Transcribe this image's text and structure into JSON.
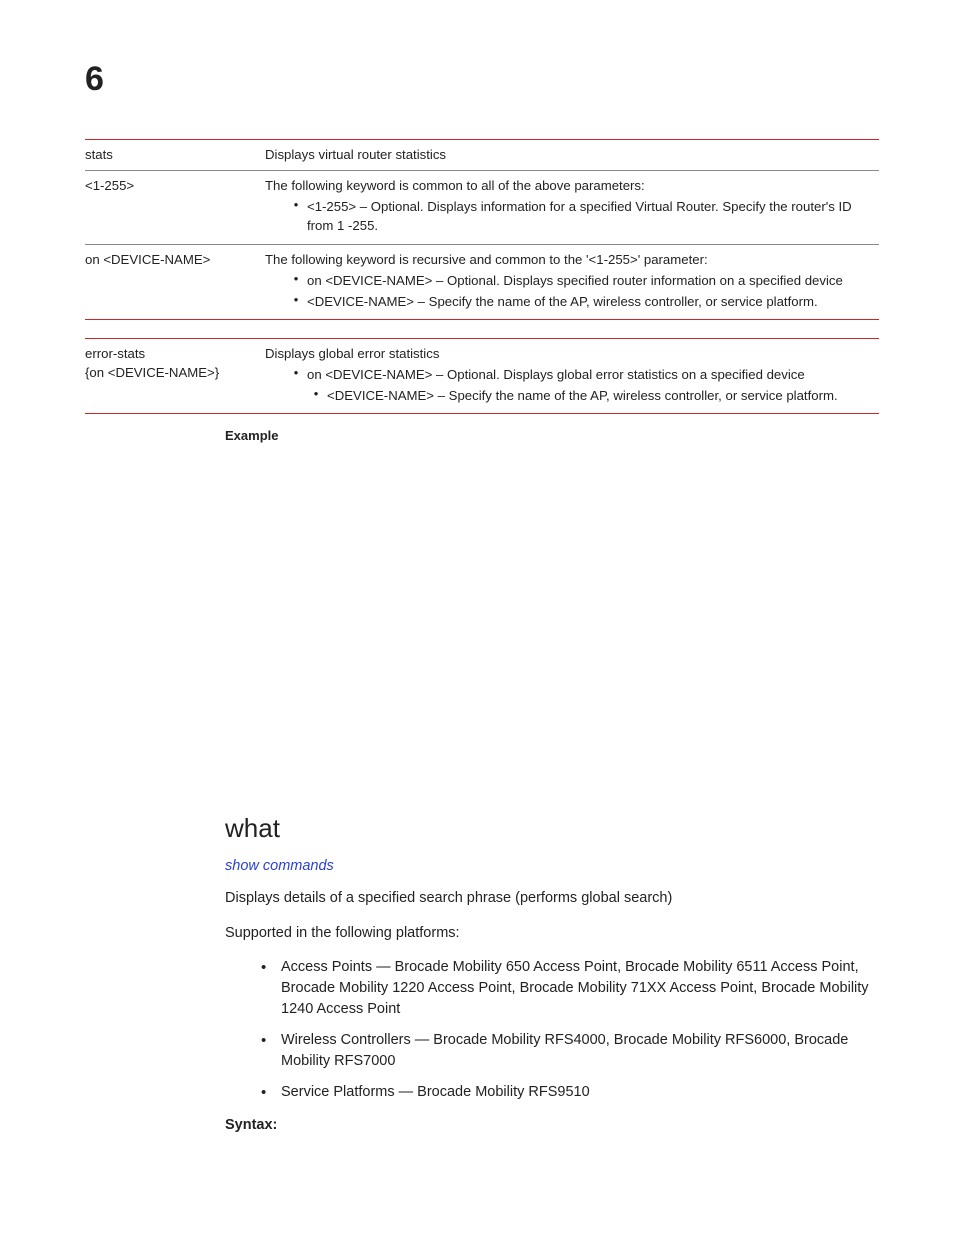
{
  "chapter": "6",
  "table1": {
    "rows": [
      {
        "key": "stats",
        "desc": {
          "intro": "Displays virtual router statistics",
          "bullets": []
        }
      },
      {
        "key": "<1-255>",
        "desc": {
          "intro": "The following keyword is common to all of the above parameters:",
          "bullets": [
            {
              "indent": 1,
              "text": "<1-255> – Optional. Displays information for a specified Virtual Router. Specify the router's ID from 1 -255."
            }
          ]
        }
      },
      {
        "key": "on <DEVICE-NAME>",
        "desc": {
          "intro": "The following keyword is recursive and common to the '<1-255>' parameter:",
          "bullets": [
            {
              "indent": 1,
              "text": "on <DEVICE-NAME> – Optional. Displays specified router information on a specified device"
            },
            {
              "indent": 1,
              "text": "<DEVICE-NAME> – Specify the name of the AP, wireless controller, or service platform."
            }
          ]
        }
      }
    ]
  },
  "table2": {
    "rows": [
      {
        "key_lines": [
          "error-stats",
          "{on <DEVICE-NAME>}"
        ],
        "desc": {
          "intro": "Displays global error statistics",
          "bullets": [
            {
              "indent": 1,
              "text": "on <DEVICE-NAME> – Optional. Displays global error statistics on a specified device"
            },
            {
              "indent": 2,
              "text": "<DEVICE-NAME> – Specify the name of the AP, wireless controller, or service platform."
            }
          ]
        }
      }
    ]
  },
  "example_label": "Example",
  "section": {
    "title": "what",
    "link": "show commands",
    "p1": "Displays details of a specified search phrase (performs global search)",
    "p2": "Supported in the following platforms:",
    "items": [
      "Access Points — Brocade Mobility 650 Access Point, Brocade Mobility 6511 Access Point, Brocade Mobility 1220 Access Point, Brocade Mobility 71XX Access Point, Brocade Mobility 1240 Access Point",
      "Wireless Controllers — Brocade Mobility RFS4000, Brocade Mobility RFS6000, Brocade Mobility RFS7000",
      "Service Platforms — Brocade Mobility RFS9510"
    ],
    "syntax": "Syntax:"
  }
}
